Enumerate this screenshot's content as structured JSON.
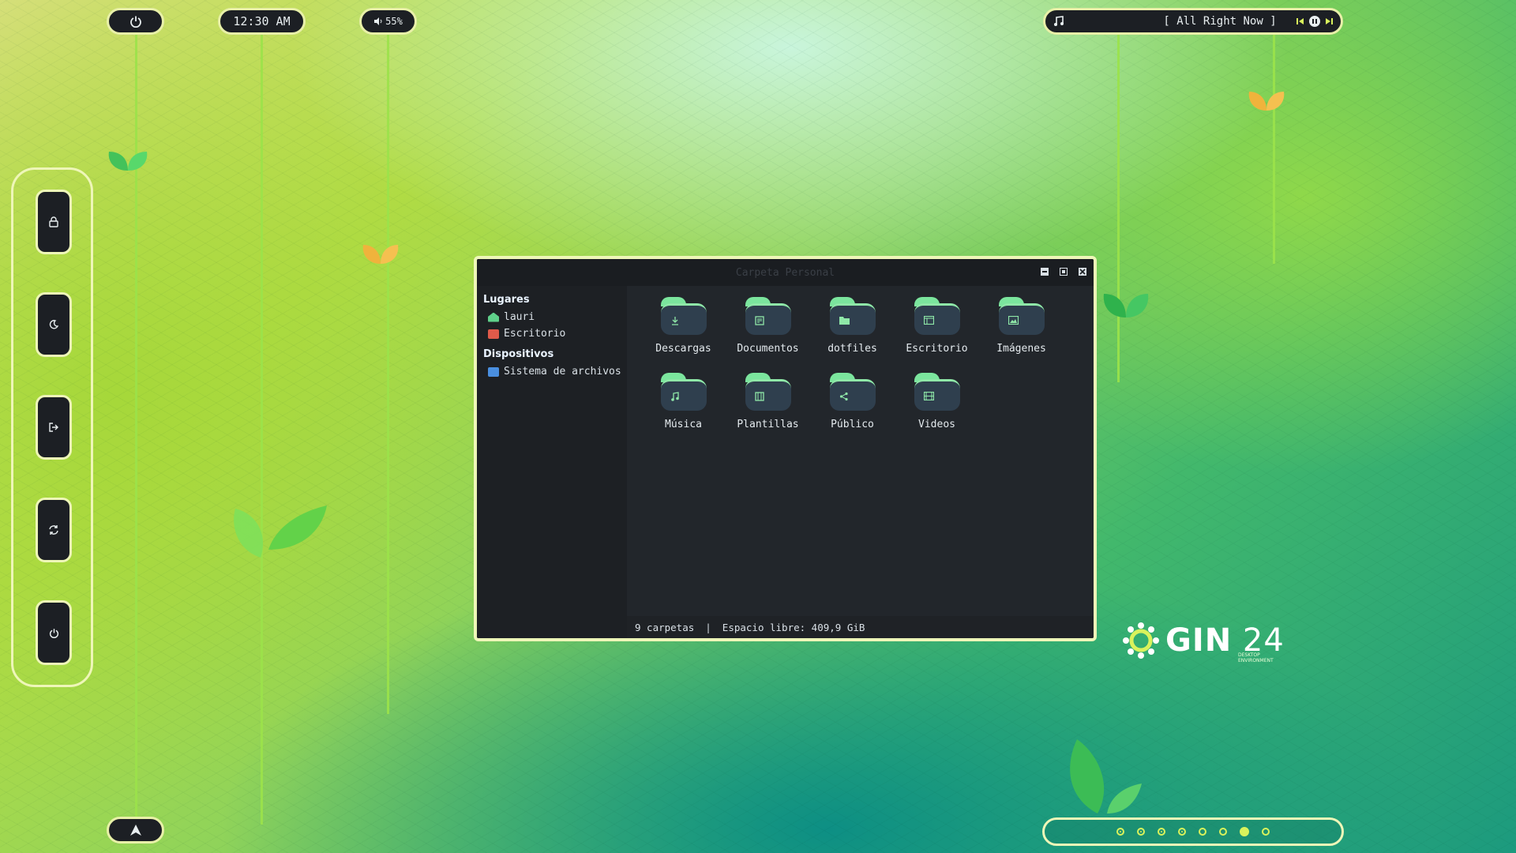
{
  "topbar": {
    "clock": "12:30 AM",
    "volume": "55%",
    "media": {
      "title": "[ All Right Now ]",
      "icons": [
        "music-note-icon",
        "previous-icon",
        "pause-icon",
        "next-icon"
      ]
    },
    "icons": [
      "power-icon",
      "volume-icon",
      "launcher-arrow-icon"
    ]
  },
  "dock": {
    "buttons": [
      "lock",
      "sleep",
      "logout",
      "restart",
      "shutdown"
    ]
  },
  "window": {
    "title": "Carpeta Personal",
    "places_heading": "Lugares",
    "places": [
      {
        "label": "lauri",
        "icon": "home-icon",
        "color": "#5fd08a"
      },
      {
        "label": "Escritorio",
        "icon": "desktop-icon",
        "color": "#e05a4a"
      }
    ],
    "devices_heading": "Dispositivos",
    "devices": [
      {
        "label": "Sistema de archivos",
        "icon": "drive-icon",
        "color": "#4a8fe0"
      }
    ],
    "folders": [
      {
        "label": "Descargas",
        "icon": "download-icon"
      },
      {
        "label": "Documentos",
        "icon": "document-icon"
      },
      {
        "label": "dotfiles",
        "icon": "folder-icon"
      },
      {
        "label": "Escritorio",
        "icon": "desktop-icon"
      },
      {
        "label": "Imágenes",
        "icon": "image-icon"
      },
      {
        "label": "Música",
        "icon": "music-icon"
      },
      {
        "label": "Plantillas",
        "icon": "template-icon"
      },
      {
        "label": "Público",
        "icon": "share-icon"
      },
      {
        "label": "Videos",
        "icon": "video-icon"
      }
    ],
    "status": {
      "count": "9 carpetas",
      "separator": "|",
      "free_space": "Espacio libre: 409,9 GiB"
    }
  },
  "logo": {
    "name": "GIN",
    "version": "24",
    "subtitle": "DESKTOP ENVIRONMENT"
  },
  "workspaces": {
    "count": 8,
    "active_index": 6
  },
  "colors": {
    "panel_bg": "#1c1f24",
    "panel_border": "#eef6b8",
    "accent_green": "#7be59d",
    "workspace_accent": "#d9f25c"
  }
}
